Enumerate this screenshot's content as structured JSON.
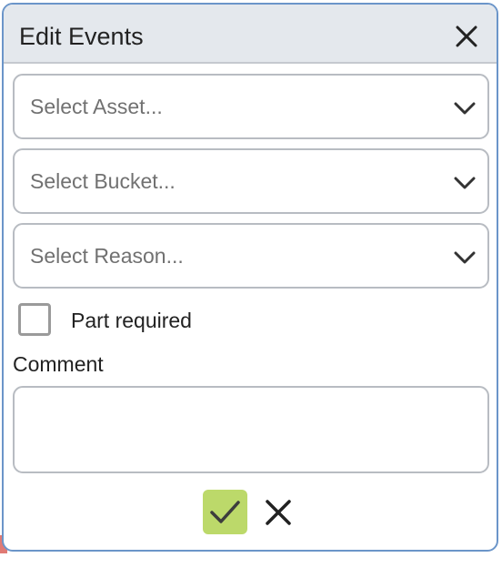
{
  "dialog": {
    "title": "Edit Events"
  },
  "selects": {
    "asset": {
      "placeholder": "Select Asset..."
    },
    "bucket": {
      "placeholder": "Select Bucket..."
    },
    "reason": {
      "placeholder": "Select Reason..."
    }
  },
  "part_required": {
    "label": "Part required",
    "checked": false
  },
  "comment": {
    "label": "Comment",
    "value": ""
  },
  "actions": {
    "confirm_icon": "check-icon",
    "cancel_icon": "close-icon"
  },
  "colors": {
    "header_bg": "#e4e8ed",
    "confirm_bg": "#bcd96a",
    "dialog_border": "#6b95c9"
  }
}
